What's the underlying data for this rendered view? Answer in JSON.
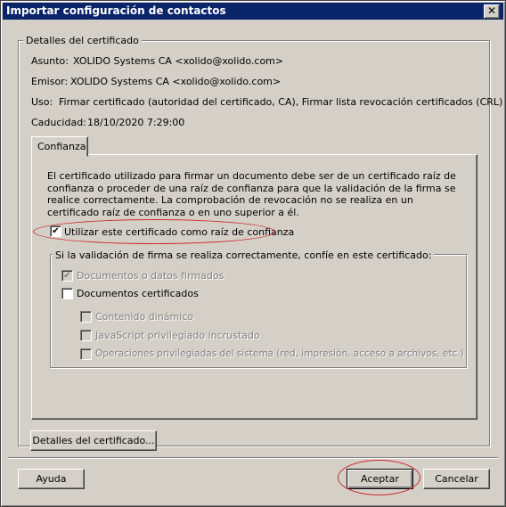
{
  "window": {
    "title": "Importar configuración de contactos",
    "close_glyph": "✕"
  },
  "certificate_details": {
    "group_label": "Detalles del certificado",
    "subject_label": "Asunto:",
    "subject_value": "XOLIDO Systems CA <xolido@xolido.com>",
    "issuer_label": "Emisor:",
    "issuer_value": "XOLIDO Systems CA <xolido@xolido.com>",
    "usage_label": "Uso:",
    "usage_value": "Firmar certificado (autoridad del certificado, CA), Firmar lista revocación certificados (CRL)",
    "expiry_label": "Caducidad:",
    "expiry_value": "18/10/2020 7:29:00"
  },
  "tabs": [
    {
      "label": "Confianza",
      "selected": true
    }
  ],
  "trust": {
    "description": "El certificado utilizado para firmar un documento debe ser de un certificado raíz de confianza o proceder de una raíz de confianza para que la validación de la firma se realice correctamente. La comprobación de revocación no se realiza en un certificado raíz de confianza o en uno superior a él.",
    "use_as_root": {
      "label": "Utilizar este certificado como raíz de confianza",
      "checked": true,
      "check_glyph": "✔"
    },
    "trust_group_label": "Si la validación de firma se realiza correctamente, confíe en este certificado:",
    "options": [
      {
        "label": "Documentos o datos firmados",
        "checked": true,
        "enabled": false,
        "check_glyph": "✔"
      },
      {
        "label": "Documentos certificados",
        "checked": false,
        "enabled": true
      },
      {
        "label": "Contenido dinámico",
        "checked": false,
        "enabled": false
      },
      {
        "label": "JavaScript privilegiado incrustado",
        "checked": false,
        "enabled": false
      },
      {
        "label": "Operaciones privilegiadas del sistema (red, impresión, acceso a archivos, etc.)",
        "checked": false,
        "enabled": false
      }
    ]
  },
  "buttons": {
    "certificate_details": "Detalles del certificado...",
    "help": "Ayuda",
    "accept": "Aceptar",
    "cancel": "Cancelar"
  },
  "colors": {
    "title_bar": "#0a246a",
    "dialog_bg": "#d4d0c8",
    "highlight_ellipse": "#cc2a2a"
  }
}
